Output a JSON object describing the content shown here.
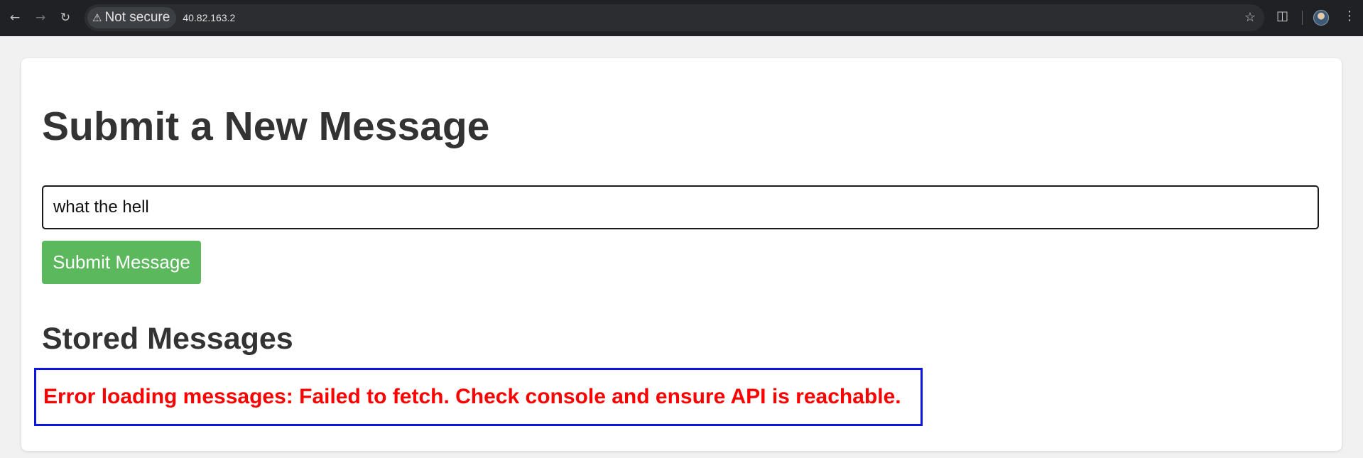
{
  "browser": {
    "security_label": "Not secure",
    "url": "40.82.163.2",
    "icons": {
      "back": "arrow-left-icon",
      "forward": "arrow-right-icon",
      "reload": "reload-icon",
      "warning": "warning-triangle-icon",
      "bookmark": "star-icon",
      "extensions": "puzzle-icon",
      "menu": "kebab-menu-icon"
    }
  },
  "page": {
    "title": "Submit a New Message",
    "input_value": "what the hell",
    "submit_label": "Submit Message",
    "stored_title": "Stored Messages",
    "error_message": "Error loading messages: Failed to fetch. Check console and ensure API is reachable."
  },
  "colors": {
    "button": "#5cb85c",
    "error_text": "#ff0000",
    "error_border": "#0b17e0",
    "heading": "#333333"
  }
}
